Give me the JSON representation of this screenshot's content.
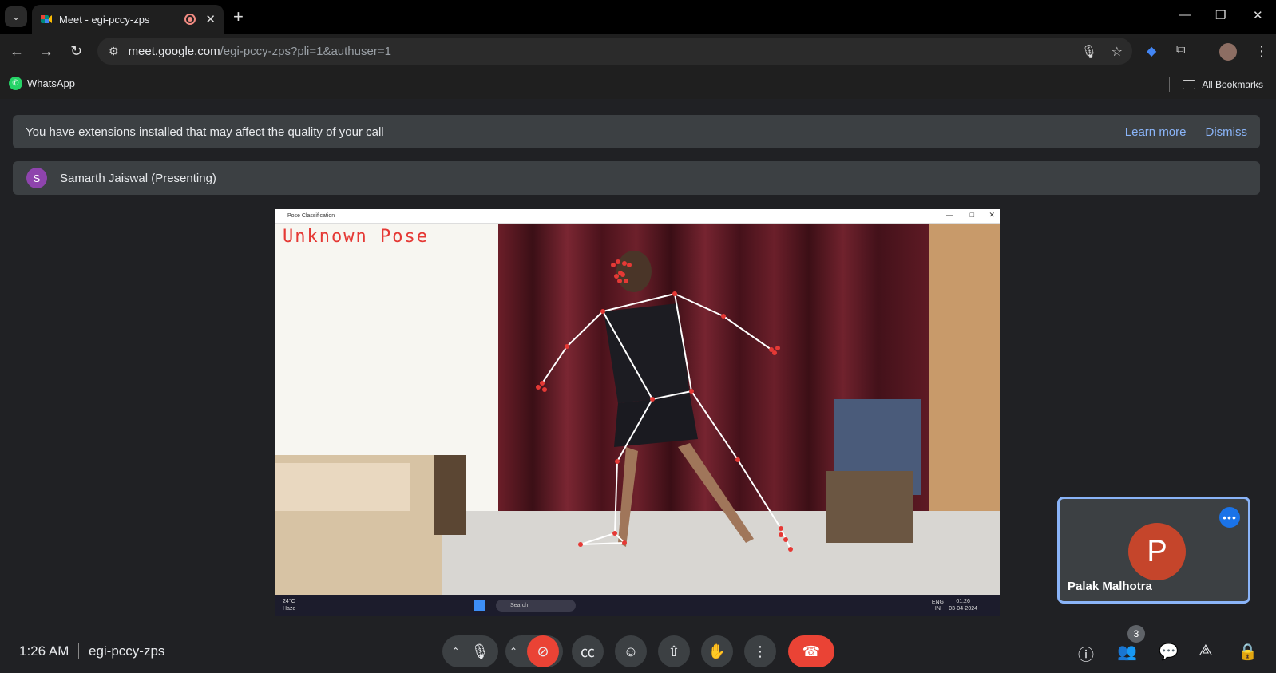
{
  "browser": {
    "tab_title": "Meet - egi-pccy-zps",
    "tab_close": "✕",
    "new_tab": "+",
    "url_host": "meet.google.com",
    "url_path": "/egi-pccy-zps?pli=1&authuser=1",
    "bookmark_whatsapp": "WhatsApp",
    "all_bookmarks": "All Bookmarks",
    "window_controls": {
      "minimize": "—",
      "restore": "❐",
      "close": "✕"
    },
    "nav": {
      "back": "←",
      "forward": "→",
      "reload": "↻"
    }
  },
  "banner": {
    "message": "You have extensions installed that may affect the quality of your call",
    "learn_more": "Learn more",
    "dismiss": "Dismiss"
  },
  "presenter": {
    "initial": "S",
    "name": "Samarth Jaiswal (Presenting)"
  },
  "shared_screen": {
    "window_title": "Pose Classification",
    "pose_label": "Unknown Pose",
    "taskbar": {
      "temp": "24°C",
      "weather": "Haze",
      "search": "Search",
      "lang": "ENG",
      "region": "IN",
      "clock_time": "01:26",
      "clock_date": "03-04-2024"
    }
  },
  "participant": {
    "initial": "P",
    "name": "Palak Malhotra",
    "more": "•••",
    "avatar_color": "#c5452b"
  },
  "footer": {
    "time": "1:26 AM",
    "meeting_code": "egi-pccy-zps",
    "people_count": "3"
  },
  "colors": {
    "accent": "#8ab4f8",
    "end_call": "#ea4335",
    "pose_text": "#e53935"
  }
}
